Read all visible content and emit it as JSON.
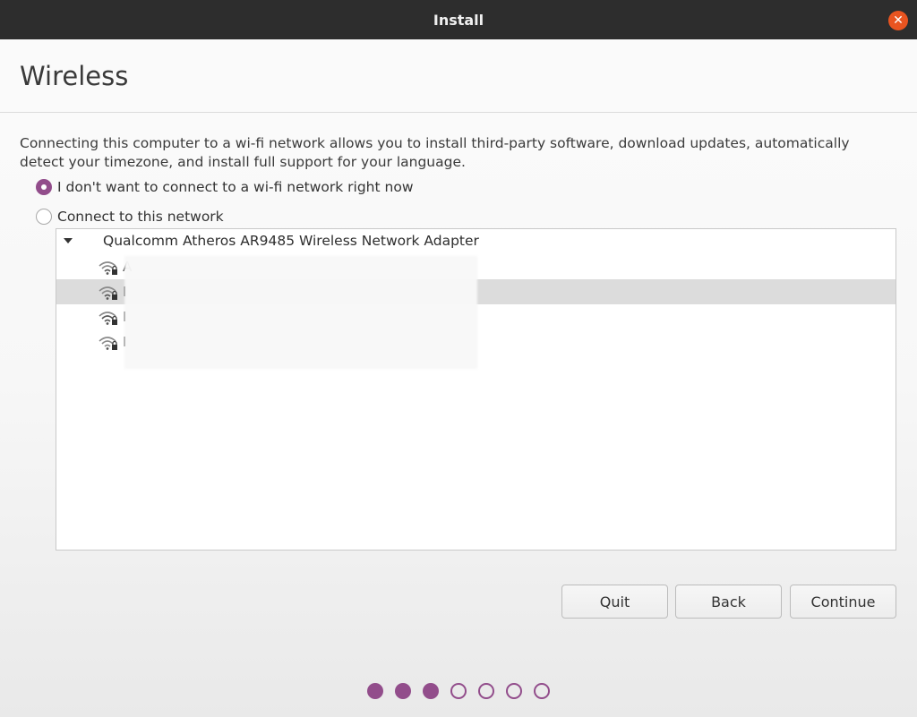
{
  "window": {
    "title": "Install",
    "close_icon": "close-icon"
  },
  "page": {
    "title": "Wireless"
  },
  "description": "Connecting this computer to a wi-fi network allows you to install third-party software, download updates, automatically detect your timezone, and install full support for your language.",
  "options": {
    "no_connect": {
      "label": "I don't want to connect to a wi-fi network right now",
      "selected": true
    },
    "connect": {
      "label": "Connect to this network",
      "selected": false
    }
  },
  "network_list": {
    "adapter": "Qualcomm Atheros AR9485 Wireless Network Adapter",
    "networks": [
      {
        "name": "A",
        "secured": true,
        "selected": false
      },
      {
        "name": "I",
        "secured": true,
        "selected": true
      },
      {
        "name": "I",
        "secured": true,
        "selected": false
      },
      {
        "name": "I",
        "secured": true,
        "selected": false
      }
    ]
  },
  "buttons": {
    "quit": "Quit",
    "back": "Back",
    "continue": "Continue"
  },
  "progress": {
    "total_steps": 7,
    "completed_steps": 3
  },
  "colors": {
    "accent": "#924d8b",
    "titlebar": "#2d2d2d",
    "close": "#e95420"
  }
}
